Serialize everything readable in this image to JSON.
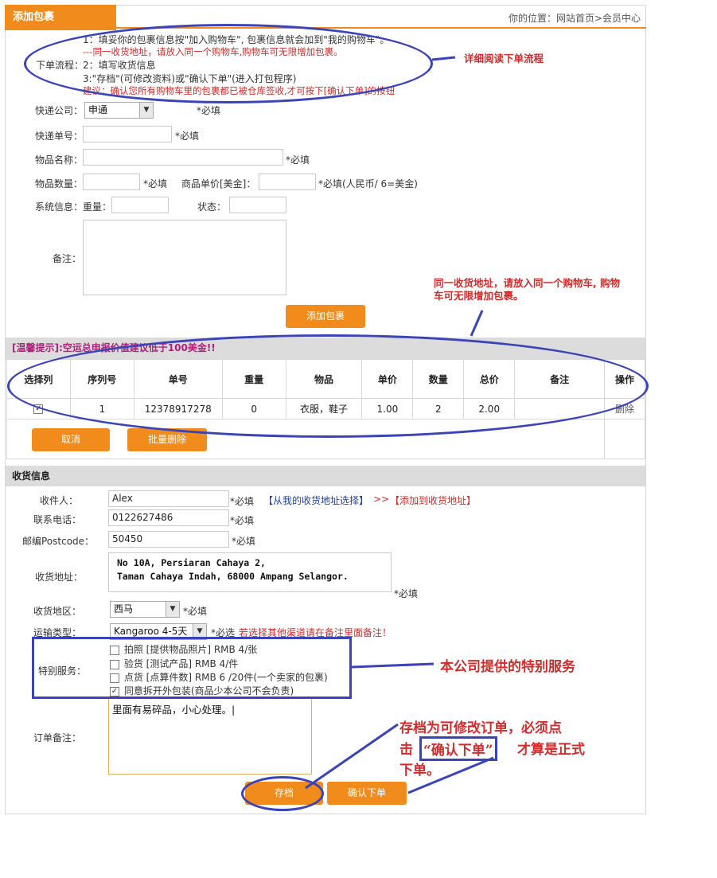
{
  "header": {
    "tab_title": "添加包裹",
    "breadcrumb": "你的位置：网站首页>会员中心"
  },
  "flow": {
    "label": "下单流程：",
    "step1": "1：填妥你的包裹信息按\"加入购物车\", 包裹信息就会加到\"我的购物车\"。",
    "step1_note": "---同一收货地址，请放入同一个购物车,购物车可无限增加包裹。",
    "step2": "2：填写收货信息",
    "step3": "3:\"存档\"(可修改资料)或\"确认下单\"(进入打包程序)",
    "tip": "建议：确认您所有购物车里的包裹都已被仓库签收,才可按下[确认下单]的按钮"
  },
  "form": {
    "courier_label": "快递公司：",
    "courier_value": "申通",
    "courier_required": "*必填",
    "tracking_label": "快递单号：",
    "tracking_required": "*必填",
    "item_name_label": "物品名称：",
    "item_name_required": "*必填",
    "qty_label": "物品数量：",
    "qty_required": "*必填",
    "price_label": "商品单价[美金]：",
    "price_required": "*必填(人民币/ 6=美金)",
    "sysinfo_label": "系统信息：重量：",
    "status_label": "状态：",
    "remark_label": "备注：",
    "add_button": "添加包裹"
  },
  "cart": {
    "tip": "[温馨提示]:空运总申报价值建议低于100美金!!",
    "columns": [
      "选择列",
      "序列号",
      "单号",
      "重量",
      "物品",
      "单价",
      "数量",
      "总价",
      "备注",
      "操作"
    ],
    "rows": [
      {
        "seq": "1",
        "tracking": "12378917278",
        "weight": "0",
        "items": "衣服，鞋子",
        "price": "1.00",
        "qty": "2",
        "total": "2.00",
        "remark": "",
        "action": "删除"
      }
    ],
    "cancel_button": "取消",
    "batch_delete_button": "批量删除"
  },
  "shipping": {
    "section_title": "收货信息",
    "recipient_label": "收件人：",
    "recipient_value": "Alex",
    "recipient_required": "*必填",
    "pick_address_link": "【从我的收货地址选择】",
    "arrows": ">>",
    "add_address_link": "【添加到收货地址】",
    "phone_label": "联系电话：",
    "phone_value": "0122627486",
    "phone_required": "*必填",
    "postcode_label": "邮编Postcode：",
    "postcode_value": "50450",
    "postcode_required": "*必填",
    "address_label": "收货地址：",
    "address_line1": "No 10A, Persiaran Cahaya 2,",
    "address_line2": "Taman Cahaya Indah, 68000 Ampang Selangor.",
    "address_required": "*必填",
    "region_label": "收货地区：",
    "region_value": "西马",
    "region_required": "*必填",
    "ship_type_label": "运输类型：",
    "ship_type_value": "Kangaroo 4-5天",
    "ship_type_required": "*必选",
    "ship_type_note": "若选择其他渠道请在备注里面备注！",
    "special_label": "特别服务：",
    "services": [
      {
        "label": "拍照 [提供物品照片] RMB 4/张",
        "checked": false
      },
      {
        "label": "验货 [测试产品] RMB 4/件",
        "checked": false
      },
      {
        "label": "点货 [点算件数] RMB 6 /20件(一个卖家的包裹)",
        "checked": false
      },
      {
        "label": "同意拆开外包装(商品少本公司不会负责)",
        "checked": true
      }
    ],
    "order_note_label": "订单备注：",
    "order_note_value": "里面有易碎品，小心处理。|",
    "save_button": "存档",
    "confirm_button": "确认下单"
  },
  "annotations": {
    "flow_note": "详细阅读下单流程",
    "cart_note_line1": "同一收货地址，请放入同一个购物车, 购物",
    "cart_note_line2": "车可无限增加包裹。",
    "service_note": "本公司提供的特别服务",
    "save_note_line1": "存档为可修改订单，必须点",
    "save_note_line2a": "击",
    "save_note_highlight": "“确认下单”",
    "save_note_line2b": "才算是正式",
    "save_note_line3": "下单。"
  },
  "colors": {
    "accent": "#f18b1c",
    "annotation_blue": "#3a44b8",
    "annotation_red": "#d42a2a",
    "tip_purple": "#b0217c"
  }
}
